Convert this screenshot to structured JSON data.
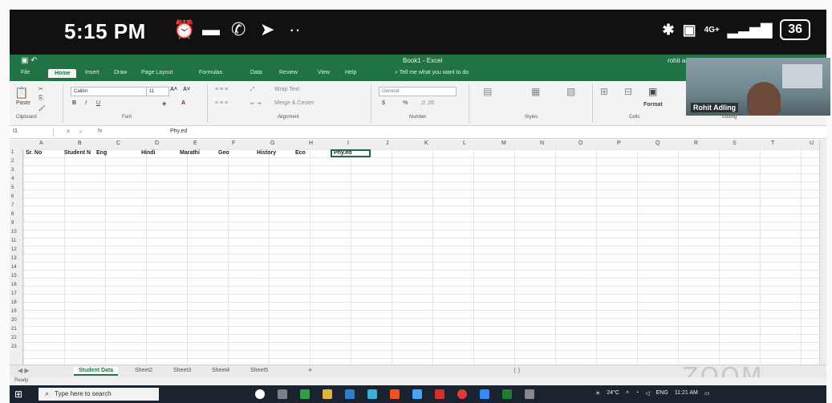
{
  "status_bar": {
    "time": "5:15 PM",
    "battery": "36",
    "signal": "4G+"
  },
  "excel": {
    "window_title": "Book1 - Excel",
    "user": "rohit adling",
    "tabs": [
      "File",
      "Home",
      "Insert",
      "Draw",
      "Page Layout",
      "Formulas",
      "Data",
      "Review",
      "View",
      "Help"
    ],
    "tell_me": "Tell me what you want to do",
    "ribbon": {
      "paste": "Paste",
      "font_name": "Calibri",
      "font_size": "11",
      "number_format": "General",
      "groups": [
        "Clipboard",
        "Font",
        "Alignment",
        "Number",
        "Styles",
        "Cells",
        "Editing"
      ],
      "wrap_text": "Wrap Text",
      "merge_center": "Merge & Center",
      "format": "Format",
      "currency": "$",
      "percent": "%"
    },
    "formula_bar": {
      "name_box": "I1",
      "fx": "fx",
      "value": "Phy.ed"
    },
    "columns": [
      "A",
      "B",
      "C",
      "D",
      "E",
      "F",
      "G",
      "H",
      "I",
      "J",
      "K",
      "L",
      "M",
      "N",
      "O",
      "P",
      "Q",
      "R",
      "S",
      "T",
      "U"
    ],
    "rows": [
      "1",
      "2",
      "3",
      "4",
      "5",
      "6",
      "7",
      "8",
      "9",
      "10",
      "11",
      "12",
      "13",
      "14",
      "15",
      "16",
      "17",
      "18",
      "19",
      "20",
      "21",
      "22",
      "23"
    ],
    "header_cells": [
      "Sr. No",
      "Student N",
      "Eng",
      "Hindi",
      "Marathi",
      "Geo",
      "History",
      "Eco",
      "Phy.ed"
    ],
    "sheets": [
      "Student Data",
      "Sheet2",
      "Sheet3",
      "Sheet4",
      "Sheet5"
    ],
    "status": "Ready",
    "add_sheet": "+"
  },
  "video": {
    "participant": "Rohit Adling"
  },
  "zoom_logo": "ZOOM",
  "taskbar": {
    "search_placeholder": "Type here to search",
    "temperature": "24°C",
    "lang": "ENG",
    "time": "11:21 AM"
  }
}
